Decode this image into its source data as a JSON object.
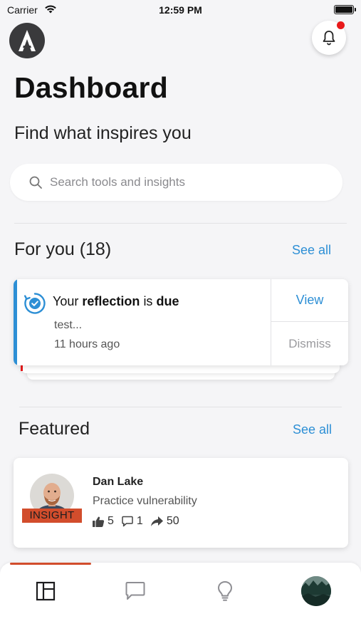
{
  "status_bar": {
    "carrier": "Carrier",
    "time": "12:59 PM"
  },
  "header": {
    "logo_icon": "app-logo-a",
    "notification_icon": "bell-icon",
    "has_unread": true
  },
  "page": {
    "title": "Dashboard",
    "subtitle": "Find what inspires you"
  },
  "search": {
    "placeholder": "Search tools and insights",
    "value": ""
  },
  "for_you": {
    "heading": "For you (18)",
    "see_all": "See all",
    "card": {
      "title_prefix": "Your",
      "title_strong1": "reflection",
      "title_mid": "is",
      "title_strong2": "due",
      "subtitle": "test...",
      "time": "11 hours ago",
      "view": "View",
      "dismiss": "Dismiss",
      "accent_color": "#2d8fd5"
    }
  },
  "featured": {
    "heading": "Featured",
    "see_all": "See all",
    "item": {
      "author": "Dan Lake",
      "title": "Practice vulnerability",
      "badge": "INSIGHT",
      "likes": "5",
      "comments": "1",
      "shares": "50"
    }
  },
  "tab_bar": {
    "items": [
      {
        "icon": "dashboard-icon",
        "active": true
      },
      {
        "icon": "chat-icon",
        "active": false
      },
      {
        "icon": "lightbulb-icon",
        "active": false
      },
      {
        "icon": "profile-avatar",
        "active": false
      }
    ],
    "active_color": "#d24d2c"
  }
}
